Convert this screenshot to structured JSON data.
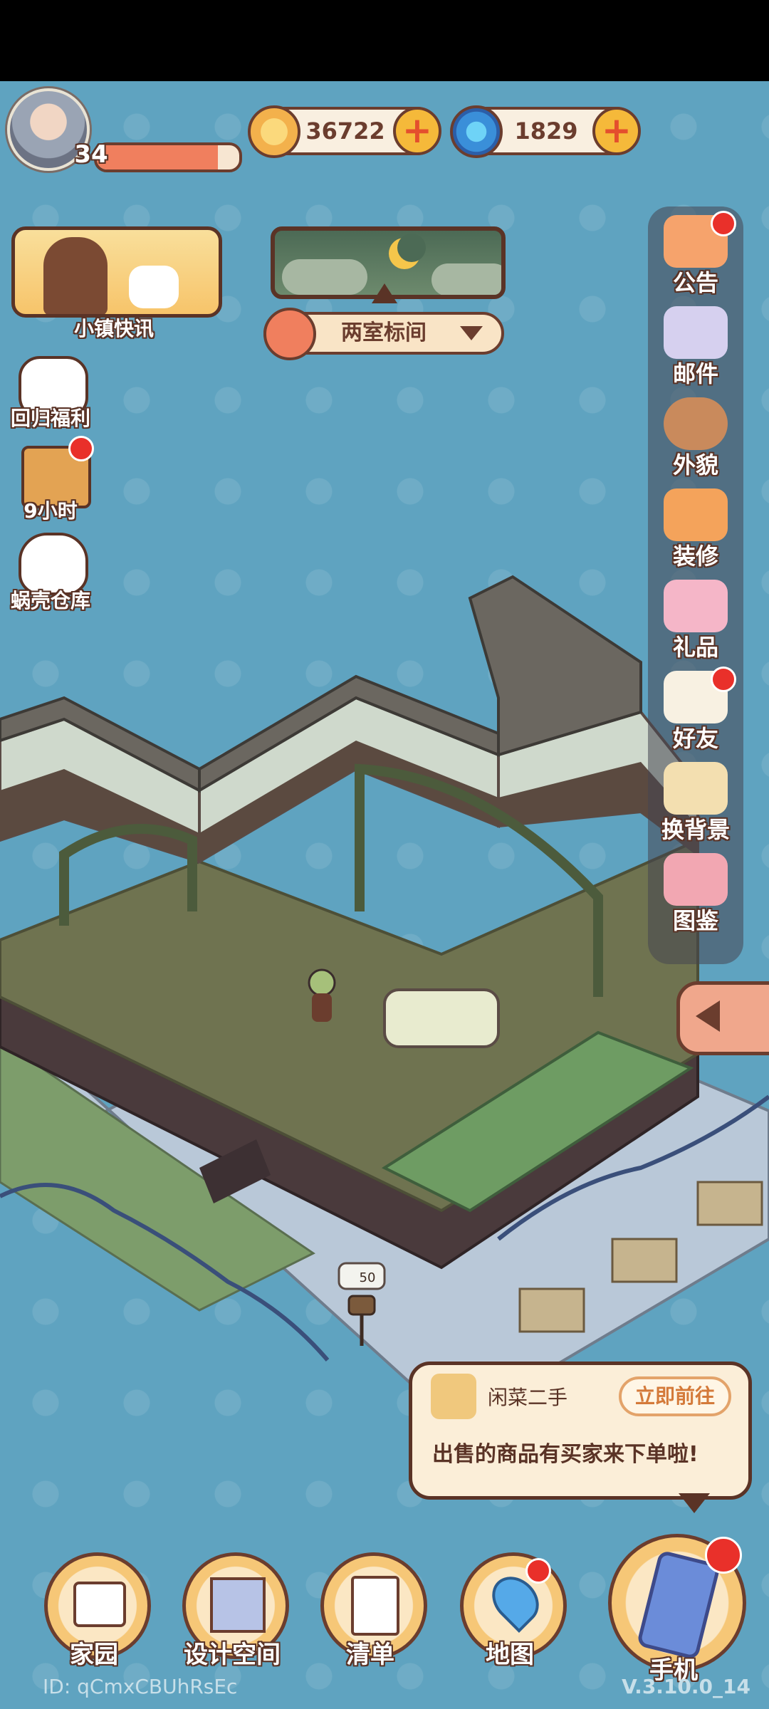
{
  "hud": {
    "level": "34",
    "level_progress": 0.85,
    "coins": "36722",
    "shells": "1829"
  },
  "news": {
    "label": "小镇快讯"
  },
  "room": {
    "name": "两室标间"
  },
  "left_items": [
    {
      "label": "回归福利",
      "icon": "cat-letter-icon"
    },
    {
      "label": "9小时",
      "icon": "treasure-chest-icon"
    },
    {
      "label": "蜗壳仓库",
      "icon": "cat-face-icon"
    }
  ],
  "right_menu": [
    {
      "label": "公告",
      "icon": "megaphone-icon",
      "badge": true
    },
    {
      "label": "邮件",
      "icon": "mail-icon",
      "badge": false
    },
    {
      "label": "外貌",
      "icon": "avatar-face-icon",
      "badge": false
    },
    {
      "label": "装修",
      "icon": "house-wrench-icon",
      "badge": false
    },
    {
      "label": "礼品",
      "icon": "gift-icon",
      "badge": false
    },
    {
      "label": "好友",
      "icon": "friend-book-icon",
      "badge": true
    },
    {
      "label": "换背景",
      "icon": "background-icon",
      "badge": false
    },
    {
      "label": "图鉴",
      "icon": "catalog-book-icon",
      "badge": false
    }
  ],
  "scene": {
    "mailbox_count": "50"
  },
  "notice": {
    "title": "闲菜二手",
    "button": "立即前往",
    "message": "出售的商品有买家来下单啦!"
  },
  "bottom_nav": [
    {
      "label": "家园",
      "icon": "home-icon",
      "badge": false
    },
    {
      "label": "设计空间",
      "icon": "design-ruler-icon",
      "badge": false
    },
    {
      "label": "清单",
      "icon": "list-quill-icon",
      "badge": false
    },
    {
      "label": "地图",
      "icon": "map-pin-icon",
      "badge": true
    }
  ],
  "phone": {
    "label": "手机",
    "badge": true
  },
  "footer": {
    "id": "ID: qCmxCBUhRsEc",
    "version": "V.3.10.0_14"
  },
  "colors": {
    "background": "#5fa3c0",
    "outline": "#5a3326",
    "badge_red": "#e9302a"
  }
}
